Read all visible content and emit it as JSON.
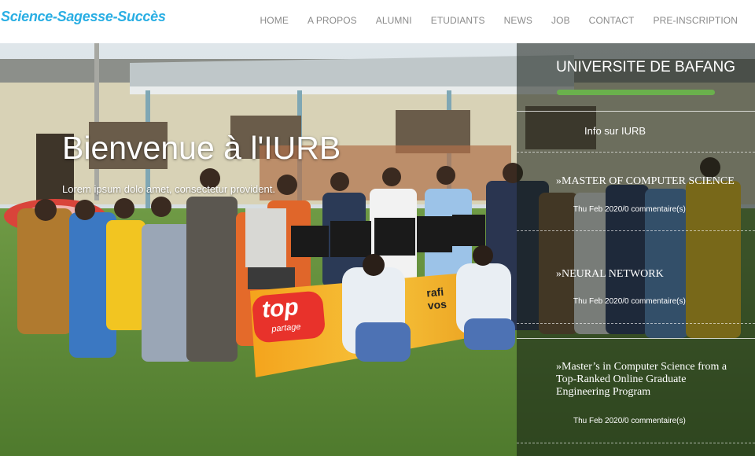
{
  "brand": {
    "tagline": "Science-Sagesse-Succès"
  },
  "nav": {
    "items": [
      "HOME",
      "A PROPOS",
      "ALUMNI",
      "ETUDIANTS",
      "NEWS",
      "JOB",
      "CONTACT",
      "PRE-INSCRIPTION"
    ]
  },
  "hero": {
    "title": "Bienvenue à l'IURB",
    "subtitle": "Lorem ipsum dolo amet, consectetur provident.",
    "banner_text": "top",
    "banner_subtext": "partage",
    "banner_text2": "rafi vos"
  },
  "panel": {
    "title": "UNIVERSITE DE BAFANG",
    "accent_color": "#6ab04c",
    "info_label": "Info sur IURB",
    "news": [
      {
        "title": "»MASTER OF COMPUTER SCIENCE",
        "meta": "Thu Feb 2020/0 commentaire(s)"
      },
      {
        "title": "»NEURAL NETWORK",
        "meta": "Thu Feb 2020/0 commentaire(s)"
      },
      {
        "title": "»Master’s in Computer Science from a Top-Ranked Online Graduate Engineering Program",
        "meta": "Thu Feb 2020/0 commentaire(s)"
      }
    ]
  },
  "colors": {
    "brand": "#29aee3",
    "nav_text": "#8a8a8a",
    "grass": "#5e8a3a"
  }
}
